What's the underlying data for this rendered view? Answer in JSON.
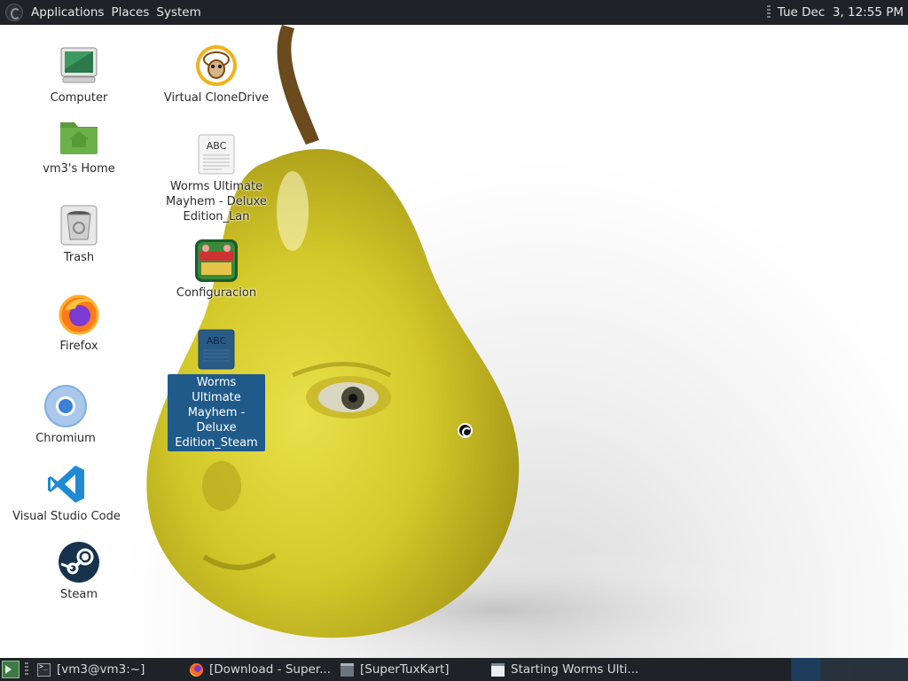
{
  "top_panel": {
    "menus": [
      "Applications",
      "Places",
      "System"
    ],
    "clock": "Tue Dec  3, 12:55 PM"
  },
  "desktop": {
    "left_icons": [
      {
        "label": "Computer",
        "icon": "computer-icon"
      },
      {
        "label": "vm3's Home",
        "icon": "home-folder-icon"
      },
      {
        "label": "Trash",
        "icon": "trash-icon"
      },
      {
        "label": "Firefox",
        "icon": "firefox-icon"
      },
      {
        "label": "Chromium",
        "icon": "chromium-icon"
      },
      {
        "label": "Visual Studio Code",
        "icon": "vscode-icon"
      },
      {
        "label": "Steam",
        "icon": "steam-icon"
      }
    ],
    "right_icons": [
      {
        "label": "Virtual CloneDrive",
        "icon": "sheep-icon"
      },
      {
        "label": "Worms Ultimate Mayhem - Deluxe Edition_Lan",
        "icon": "text-file-icon"
      },
      {
        "label": "Configuracion",
        "icon": "worms-game-icon"
      },
      {
        "label": "Worms Ultimate Mayhem - Deluxe Edition_Steam",
        "icon": "text-file-icon",
        "selected": true
      }
    ]
  },
  "taskbar": {
    "tasks": [
      {
        "label": "[vm3@vm3:~]",
        "icon": "terminal-icon"
      },
      {
        "label": "[Download - Super...",
        "icon": "firefox-icon"
      },
      {
        "label": "[SuperTuxKart]",
        "icon": "window-icon"
      },
      {
        "label": "Starting Worms Ulti...",
        "icon": "document-icon"
      }
    ]
  },
  "colors": {
    "panel_bg": "#1f2328",
    "selection": "#1f5a8a",
    "pear_yellow": "#d9d02e"
  }
}
